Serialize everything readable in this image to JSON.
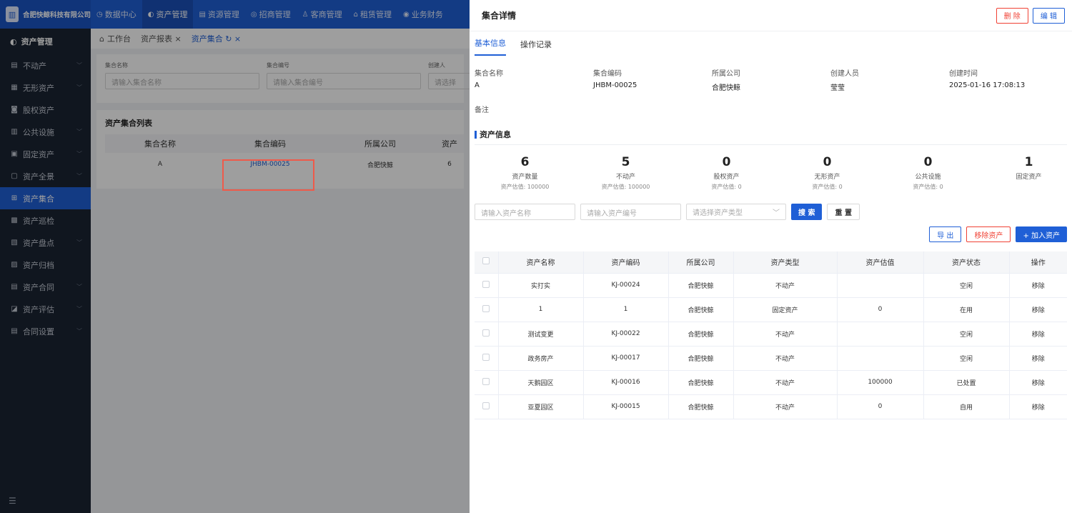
{
  "topbar": {
    "company": "合肥快鲸科技有限公司",
    "nav": [
      {
        "label": "数据中心",
        "icon": "◷"
      },
      {
        "label": "资产管理",
        "icon": "◐"
      },
      {
        "label": "资源管理",
        "icon": "▤"
      },
      {
        "label": "招商管理",
        "icon": "◎"
      },
      {
        "label": "客商管理",
        "icon": "♙"
      },
      {
        "label": "租赁管理",
        "icon": "⌂"
      },
      {
        "label": "业务财务",
        "icon": "◉"
      }
    ]
  },
  "sidebar": {
    "header": "资产管理",
    "items": [
      {
        "label": "不动产",
        "icon": "▤",
        "arrow": "﹀"
      },
      {
        "label": "无形资产",
        "icon": "▦",
        "arrow": "﹀"
      },
      {
        "label": "股权资产",
        "icon": "◙",
        "arrow": ""
      },
      {
        "label": "公共设施",
        "icon": "▥",
        "arrow": "﹀"
      },
      {
        "label": "固定资产",
        "icon": "▣",
        "arrow": "﹀"
      },
      {
        "label": "资产全景",
        "icon": "▢",
        "arrow": "﹀"
      },
      {
        "label": "资产集合",
        "icon": "⊞",
        "arrow": ""
      },
      {
        "label": "资产巡检",
        "icon": "▩",
        "arrow": ""
      },
      {
        "label": "资产盘点",
        "icon": "▧",
        "arrow": "﹀"
      },
      {
        "label": "资产归档",
        "icon": "▨",
        "arrow": ""
      },
      {
        "label": "资产合同",
        "icon": "▤",
        "arrow": "﹀"
      },
      {
        "label": "资产评估",
        "icon": "◪",
        "arrow": "﹀"
      },
      {
        "label": "合同设置",
        "icon": "▤",
        "arrow": "﹀"
      }
    ],
    "footer_icon": "☰"
  },
  "main": {
    "tabs": [
      "工作台",
      "资产报表 ×",
      "资产集合 ↻ ×"
    ],
    "filter": {
      "name_label": "集合名称",
      "name_placeholder": "请输入集合名称",
      "code_label": "集合编号",
      "code_placeholder": "请输入集合编号",
      "creator_label": "创建人",
      "creator_placeholder": "请选择"
    },
    "list_title": "资产集合列表",
    "columns": [
      "集合名称",
      "集合编码",
      "所属公司",
      "资产"
    ],
    "row": [
      "A",
      "JHBM-00025",
      "合肥快鲸",
      "6"
    ]
  },
  "drawer": {
    "title": "集合详情",
    "delete_label": "删 除",
    "edit_label": "编 辑",
    "tabs": [
      "基本信息",
      "操作记录"
    ],
    "info": [
      {
        "label": "集合名称",
        "value": "A"
      },
      {
        "label": "集合编码",
        "value": "JHBM-00025"
      },
      {
        "label": "所属公司",
        "value": "合肥快鲸"
      },
      {
        "label": "创建人员",
        "value": "莹莹"
      },
      {
        "label": "创建时间",
        "value": "2025-01-16 17:08:13"
      }
    ],
    "remark_label": "备注",
    "section_title": "资产信息",
    "stats": [
      {
        "num": "6",
        "label": "资产数量",
        "sub": "资产估值: 100000"
      },
      {
        "num": "5",
        "label": "不动产",
        "sub": "资产估值: 100000"
      },
      {
        "num": "0",
        "label": "股权资产",
        "sub": "资产估值: 0"
      },
      {
        "num": "0",
        "label": "无形资产",
        "sub": "资产估值: 0"
      },
      {
        "num": "0",
        "label": "公共设施",
        "sub": "资产估值: 0"
      },
      {
        "num": "1",
        "label": "固定资产",
        "sub": ""
      }
    ],
    "search": {
      "name_placeholder": "请输入资产名称",
      "code_placeholder": "请输入资产编号",
      "type_placeholder": "请选择资产类型",
      "search_label": "搜 索",
      "reset_label": "重 置"
    },
    "actions": {
      "export": "导 出",
      "remove": "移除资产",
      "add": "+ 加入资产"
    },
    "table": {
      "columns": [
        "资产名称",
        "资产编码",
        "所属公司",
        "资产类型",
        "资产估值",
        "资产状态",
        "操作"
      ],
      "rows": [
        {
          "name": "实打实",
          "code": "KJ-00024",
          "company": "合肥快鲸",
          "type": "不动产",
          "type_color": "blue",
          "value": "",
          "status": "空闲",
          "op": "移除"
        },
        {
          "name": "1",
          "code": "1",
          "company": "合肥快鲸",
          "type": "固定资产",
          "type_color": "red",
          "value": "0",
          "status": "在用",
          "op": "移除"
        },
        {
          "name": "测试变更",
          "code": "KJ-00022",
          "company": "合肥快鲸",
          "type": "不动产",
          "type_color": "blue",
          "value": "",
          "status": "空闲",
          "op": "移除"
        },
        {
          "name": "政务房产",
          "code": "KJ-00017",
          "company": "合肥快鲸",
          "type": "不动产",
          "type_color": "blue",
          "value": "",
          "status": "空闲",
          "op": "移除"
        },
        {
          "name": "天鹅园区",
          "code": "KJ-00016",
          "company": "合肥快鲸",
          "type": "不动产",
          "type_color": "blue",
          "value": "100000",
          "status": "已处置",
          "op": "移除"
        },
        {
          "name": "亚夏园区",
          "code": "KJ-00015",
          "company": "合肥快鲸",
          "type": "不动产",
          "type_color": "blue",
          "value": "0",
          "status": "自用",
          "op": "移除"
        }
      ]
    }
  },
  "colors": {
    "primary": "#1f5fd6",
    "danger": "#f04134",
    "sidebar": "#1b2433",
    "highlight": "#ef5a4a"
  }
}
